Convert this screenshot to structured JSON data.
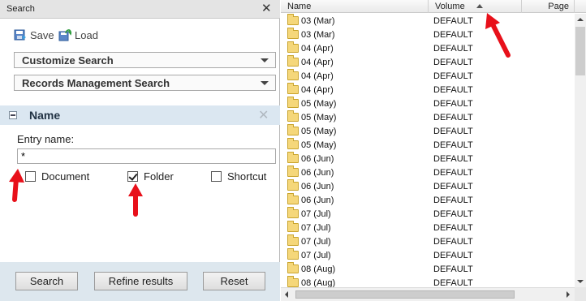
{
  "search_panel": {
    "title": "Search",
    "close_icon": "close-icon",
    "toolbar": {
      "save_label": "Save",
      "save_icon": "save-icon",
      "load_label": "Load",
      "load_icon": "load-icon"
    },
    "dropdowns": [
      {
        "label": "Customize Search"
      },
      {
        "label": "Records Management Search"
      }
    ],
    "name_section": {
      "title": "Name",
      "entry_label": "Entry name:",
      "entry_value": "*",
      "checkboxes": [
        {
          "label": "Document",
          "checked": false
        },
        {
          "label": "Folder",
          "checked": true
        },
        {
          "label": "Shortcut",
          "checked": false
        }
      ]
    },
    "buttons": {
      "search": "Search",
      "refine": "Refine results",
      "reset": "Reset"
    }
  },
  "results": {
    "columns": [
      {
        "label": "Name"
      },
      {
        "label": "Volume",
        "sorted": "ascending"
      },
      {
        "label": "Page"
      }
    ],
    "rows": [
      {
        "name": "03 (Mar)",
        "volume": "DEFAULT"
      },
      {
        "name": "03 (Mar)",
        "volume": "DEFAULT"
      },
      {
        "name": "04 (Apr)",
        "volume": "DEFAULT"
      },
      {
        "name": "04 (Apr)",
        "volume": "DEFAULT"
      },
      {
        "name": "04 (Apr)",
        "volume": "DEFAULT"
      },
      {
        "name": "04 (Apr)",
        "volume": "DEFAULT"
      },
      {
        "name": "05 (May)",
        "volume": "DEFAULT"
      },
      {
        "name": "05 (May)",
        "volume": "DEFAULT"
      },
      {
        "name": "05 (May)",
        "volume": "DEFAULT"
      },
      {
        "name": "05 (May)",
        "volume": "DEFAULT"
      },
      {
        "name": "06 (Jun)",
        "volume": "DEFAULT"
      },
      {
        "name": "06 (Jun)",
        "volume": "DEFAULT"
      },
      {
        "name": "06 (Jun)",
        "volume": "DEFAULT"
      },
      {
        "name": "06 (Jun)",
        "volume": "DEFAULT"
      },
      {
        "name": "07 (Jul)",
        "volume": "DEFAULT"
      },
      {
        "name": "07 (Jul)",
        "volume": "DEFAULT"
      },
      {
        "name": "07 (Jul)",
        "volume": "DEFAULT"
      },
      {
        "name": "07 (Jul)",
        "volume": "DEFAULT"
      },
      {
        "name": "08 (Aug)",
        "volume": "DEFAULT"
      },
      {
        "name": "08 (Aug)",
        "volume": "DEFAULT"
      }
    ]
  },
  "colors": {
    "annotation_arrow": "#e8101a",
    "section_header_bg": "#dbe7f1",
    "footer_bg": "#dde7ee",
    "folder_icon": "#f5d77a"
  }
}
